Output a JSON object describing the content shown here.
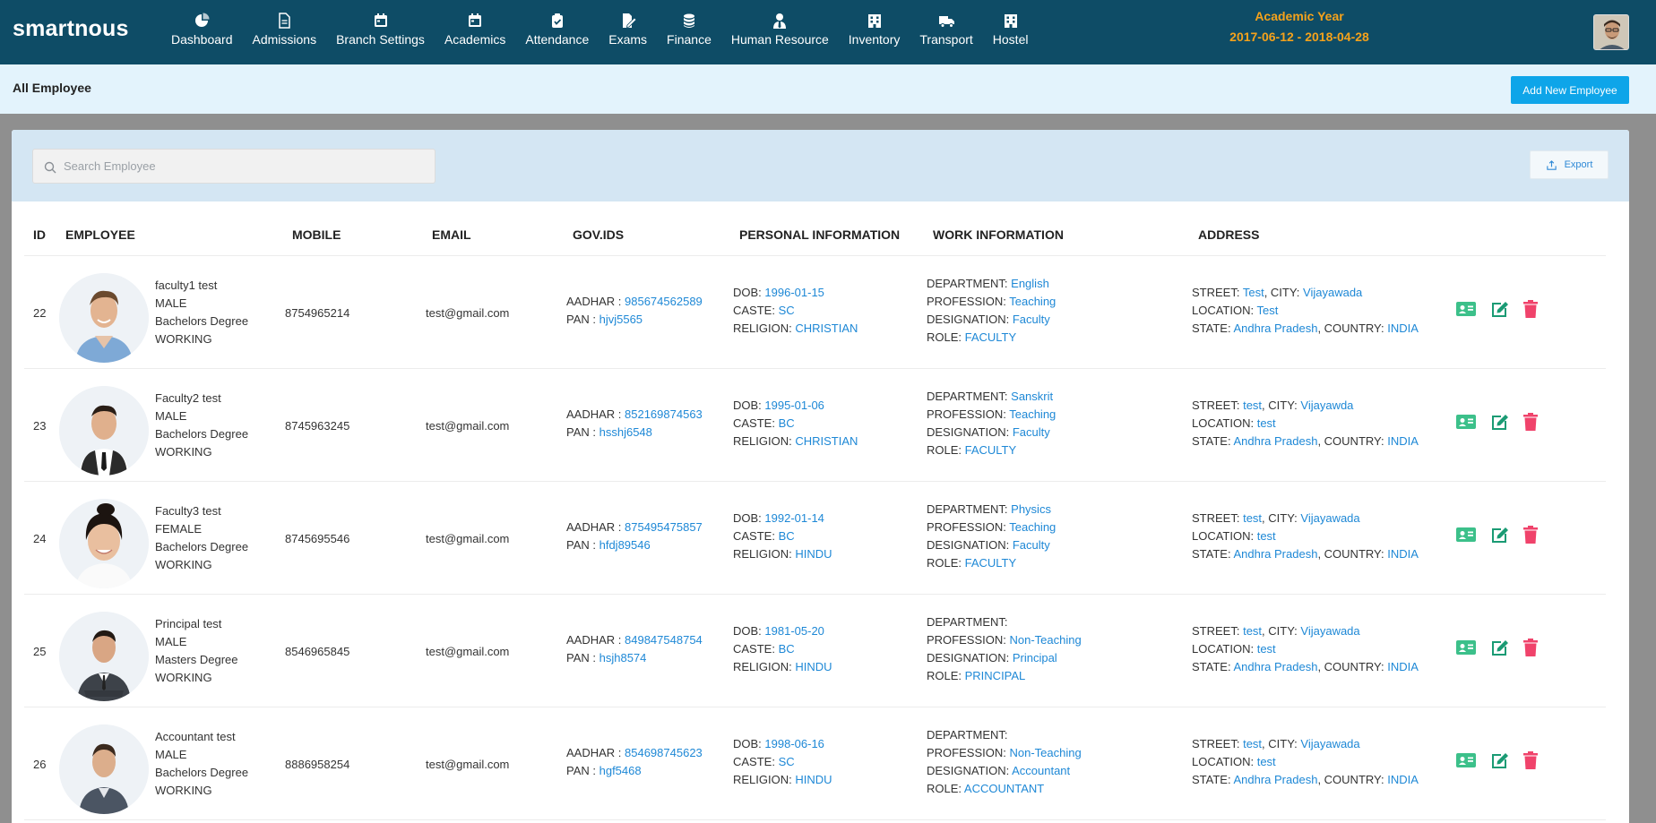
{
  "brand": "smartnous",
  "nav": [
    {
      "label": "Dashboard",
      "icon": "pie-chart-icon"
    },
    {
      "label": "Admissions",
      "icon": "document-icon"
    },
    {
      "label": "Branch Settings",
      "icon": "calendar-icon"
    },
    {
      "label": "Academics",
      "icon": "calendar-icon"
    },
    {
      "label": "Attendance",
      "icon": "clipboard-check-icon"
    },
    {
      "label": "Exams",
      "icon": "edit-document-icon"
    },
    {
      "label": "Finance",
      "icon": "coins-icon"
    },
    {
      "label": "Human Resource",
      "icon": "user-tie-icon"
    },
    {
      "label": "Inventory",
      "icon": "building-icon"
    },
    {
      "label": "Transport",
      "icon": "truck-icon"
    },
    {
      "label": "Hostel",
      "icon": "building-icon"
    }
  ],
  "academic_year": {
    "label": "Academic Year",
    "range": "2017-06-12 - 2018-04-28"
  },
  "page_title": "All Employee",
  "add_button": "Add New Employee",
  "search": {
    "placeholder": "Search Employee"
  },
  "export_button": "Export",
  "columns": [
    "ID",
    "EMPLOYEE",
    "MOBILE",
    "EMAIL",
    "GOV.IDS",
    "PERSONAL INFORMATION",
    "WORK INFORMATION",
    "ADDRESS"
  ],
  "labels": {
    "aadhar": "AADHAR : ",
    "pan": "PAN : ",
    "dob": "DOB: ",
    "caste": "CASTE: ",
    "religion": "RELIGION: ",
    "department": "DEPARTMENT: ",
    "profession": "PROFESSION: ",
    "designation": "DESIGNATION: ",
    "role": "ROLE: ",
    "street": "STREET: ",
    "city": ", CITY: ",
    "location": "LOCATION: ",
    "state": "STATE: ",
    "country": ", COUNTRY: "
  },
  "colors": {
    "nav_bg": "#0e4c66",
    "accent": "#0ea5e9",
    "link": "#1e88d6",
    "year": "#f5a21b",
    "id_card": "#3cc08a",
    "edit": "#1a9b74",
    "delete": "#f0436b"
  },
  "employees": [
    {
      "id": "22",
      "name": "faculty1 test",
      "gender": "MALE",
      "degree": "Bachelors Degree",
      "status": "WORKING",
      "mobile": "8754965214",
      "email": "test@gmail.com",
      "aadhar": "985674562589",
      "pan": "hjvj5565",
      "dob": "1996-01-15",
      "caste": "SC",
      "religion": "CHRISTIAN",
      "department": "English",
      "profession": "Teaching",
      "designation": "Faculty",
      "role": "FACULTY",
      "street": "Test",
      "city": "Vijayawada",
      "location": "Test",
      "state": "Andhra Pradesh",
      "country": "INDIA"
    },
    {
      "id": "23",
      "name": "Faculty2 test",
      "gender": "MALE",
      "degree": "Bachelors Degree",
      "status": "WORKING",
      "mobile": "8745963245",
      "email": "test@gmail.com",
      "aadhar": "852169874563",
      "pan": "hsshj6548",
      "dob": "1995-01-06",
      "caste": "BC",
      "religion": "CHRISTIAN",
      "department": "Sanskrit",
      "profession": "Teaching",
      "designation": "Faculty",
      "role": "FACULTY",
      "street": "test",
      "city": "Vijayawda",
      "location": "test",
      "state": "Andhra Pradesh",
      "country": "INDIA"
    },
    {
      "id": "24",
      "name": "Faculty3 test",
      "gender": "FEMALE",
      "degree": "Bachelors Degree",
      "status": "WORKING",
      "mobile": "8745695546",
      "email": "test@gmail.com",
      "aadhar": "875495475857",
      "pan": "hfdj89546",
      "dob": "1992-01-14",
      "caste": "BC",
      "religion": "HINDU",
      "department": "Physics",
      "profession": "Teaching",
      "designation": "Faculty",
      "role": "FACULTY",
      "street": "test",
      "city": "Vijayawada",
      "location": "test",
      "state": "Andhra Pradesh",
      "country": "INDIA"
    },
    {
      "id": "25",
      "name": "Principal test",
      "gender": "MALE",
      "degree": "Masters Degree",
      "status": "WORKING",
      "mobile": "8546965845",
      "email": "test@gmail.com",
      "aadhar": "849847548754",
      "pan": "hsjh8574",
      "dob": "1981-05-20",
      "caste": "BC",
      "religion": "HINDU",
      "department": "",
      "profession": "Non-Teaching",
      "designation": "Principal",
      "role": "PRINCIPAL",
      "street": "test",
      "city": "Vijayawada",
      "location": "test",
      "state": "Andhra Pradesh",
      "country": "INDIA"
    },
    {
      "id": "26",
      "name": "Accountant test",
      "gender": "MALE",
      "degree": "Bachelors Degree",
      "status": "WORKING",
      "mobile": "8886958254",
      "email": "test@gmail.com",
      "aadhar": "854698745623",
      "pan": "hgf5468",
      "dob": "1998-06-16",
      "caste": "SC",
      "religion": "HINDU",
      "department": "",
      "profession": "Non-Teaching",
      "designation": "Accountant",
      "role": "ACCOUNTANT",
      "street": "test",
      "city": "Vijayawada",
      "location": "test",
      "state": "Andhra Pradesh",
      "country": "INDIA"
    }
  ]
}
